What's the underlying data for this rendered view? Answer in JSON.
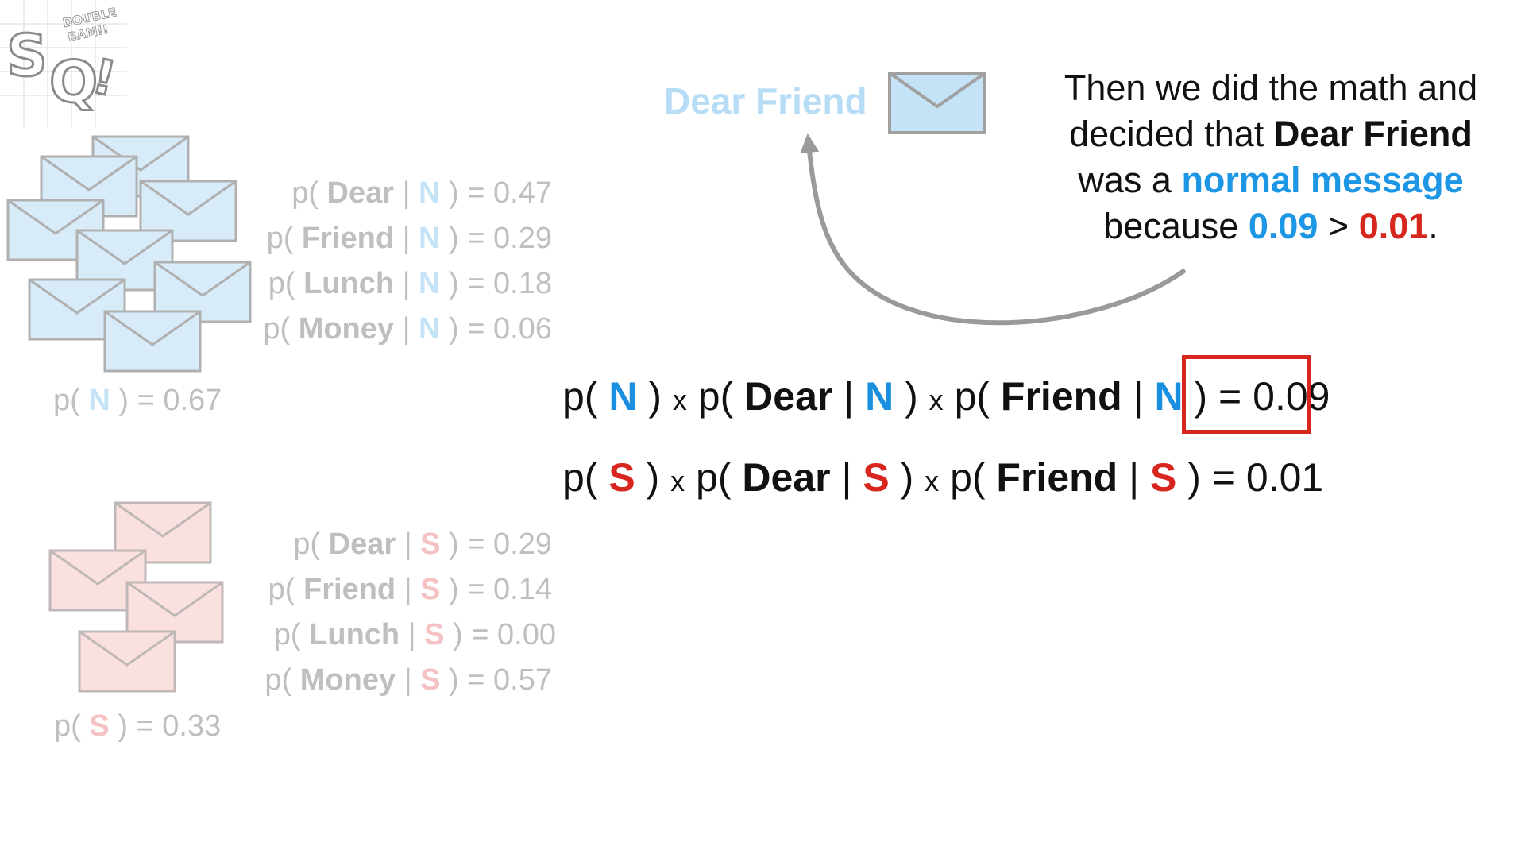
{
  "logo": {
    "letters": "SQ!",
    "tagline": "DOUBLE BAM!!"
  },
  "normal_group": {
    "color": "#d7ebf9",
    "prior": {
      "label": "N",
      "value": "0.67"
    },
    "likelihoods": [
      {
        "word": "Dear",
        "cls": "N",
        "value": "0.47"
      },
      {
        "word": "Friend",
        "cls": "N",
        "value": "0.29"
      },
      {
        "word": "Lunch",
        "cls": "N",
        "value": "0.18"
      },
      {
        "word": "Money",
        "cls": "N",
        "value": "0.06"
      }
    ]
  },
  "spam_group": {
    "color": "#fbe0e0",
    "prior": {
      "label": "S",
      "value": "0.33"
    },
    "likelihoods": [
      {
        "word": "Dear",
        "cls": "S",
        "value": "0.29"
      },
      {
        "word": "Friend",
        "cls": "S",
        "value": "0.14"
      },
      {
        "word": "Lunch",
        "cls": "S",
        "value": "0.00"
      },
      {
        "word": "Money",
        "cls": "S",
        "value": "0.57"
      }
    ]
  },
  "message": {
    "text": "Dear Friend"
  },
  "caption": {
    "line1": "Then we did the math and",
    "line2_pre": "decided that ",
    "line2_bold": "Dear Friend",
    "line3_pre": "was a ",
    "line3_blue": "normal message",
    "line4_pre": "because ",
    "line4_blue": "0.09",
    "line4_mid": " > ",
    "line4_red": "0.01",
    "line4_end": "."
  },
  "equation_normal": {
    "cls": "N",
    "word1": "Dear",
    "word2": "Friend",
    "result": "= 0.09"
  },
  "equation_spam": {
    "cls": "S",
    "word1": "Dear",
    "word2": "Friend",
    "result": "= 0.01"
  },
  "colors": {
    "normal": "#1a8fe0",
    "spam": "#d7261e",
    "highlight": "#d7261e"
  }
}
